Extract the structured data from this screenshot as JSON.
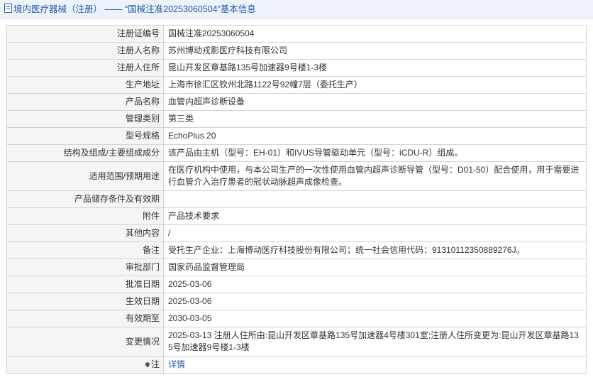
{
  "header": {
    "title_prefix": "境内医疗器械（注册）",
    "title_dash": " —— ",
    "title_main": "“国械注准20253060504”基本信息"
  },
  "rows": [
    {
      "label": "注册证编号",
      "value": "国械注准20253060504"
    },
    {
      "label": "注册人名称",
      "value": "苏州博动戎影医疗科技有限公司"
    },
    {
      "label": "注册人住所",
      "value": "昆山开发区章基路135号加速器9号楼1-3楼"
    },
    {
      "label": "生产地址",
      "value": "上海市徐汇区钦州北路1122号92幢7层（委托生产）"
    },
    {
      "label": "产品名称",
      "value": "血管内超声诊断设备"
    },
    {
      "label": "管理类别",
      "value": "第三类"
    },
    {
      "label": "型号规格",
      "value": "EchoPlus 20"
    },
    {
      "label": "结构及组成/主要组成成分",
      "value": "该产品由主机（型号：EH-01）和IVUS导管驱动单元（型号：iCDU-R）组成。"
    },
    {
      "label": "适用范围/预期用途",
      "value": "在医疗机构中使用，与本公司生产的一次性使用血管内超声诊断导管（型号：D01-50）配合使用，用于需要进行血管介入治疗患者的冠状动脉超声成像检查。"
    },
    {
      "label": "产品储存条件及有效期",
      "value": ""
    },
    {
      "label": "附件",
      "value": "产品技术要求"
    },
    {
      "label": "其他内容",
      "value": "/"
    },
    {
      "label": "备注",
      "value": "受托生产企业：上海博动医疗科技股份有限公司；统一社会信用代码：91310112350889276J。"
    },
    {
      "label": "审批部门",
      "value": "国家药品监督管理局"
    },
    {
      "label": "批准日期",
      "value": "2025-03-06"
    },
    {
      "label": "生效日期",
      "value": "2025-03-06"
    },
    {
      "label": "有效期至",
      "value": "2030-03-05"
    },
    {
      "label": "变更情况",
      "value": "2025-03-13 注册人住所由:昆山开发区章基路135号加速器4号楼301室;注册人住所变更为:昆山开发区章基路135号加速器9号楼1-3楼"
    }
  ],
  "note": {
    "label": "注",
    "link": "详情"
  }
}
